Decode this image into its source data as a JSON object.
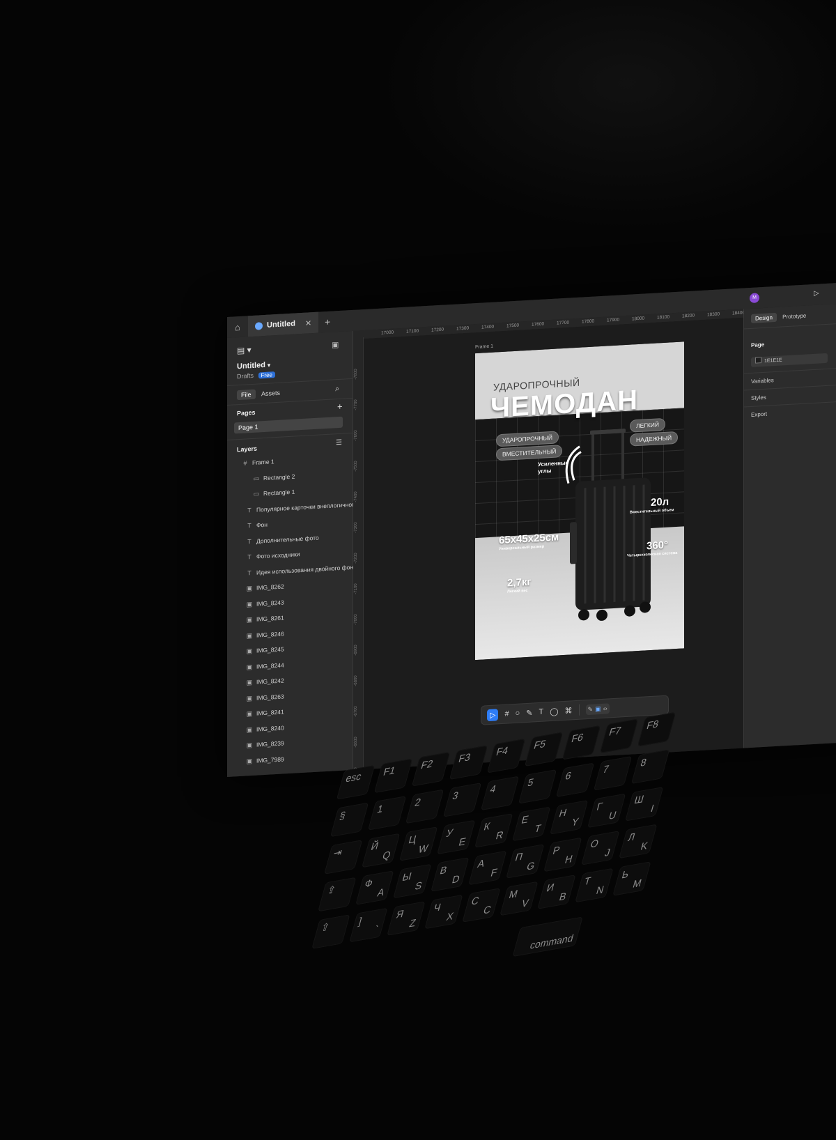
{
  "tab": {
    "title": "Untitled",
    "close": "✕",
    "add": "+"
  },
  "file": {
    "title": "Untitled",
    "location": "Drafts",
    "plan_badge": "Free"
  },
  "panel_tabs": {
    "file": "File",
    "assets": "Assets"
  },
  "pages": {
    "heading": "Pages",
    "add": "+",
    "items": [
      "Page 1"
    ]
  },
  "layers": {
    "heading": "Layers",
    "items": [
      {
        "name": "Frame 1",
        "icon": "frame-icon"
      },
      {
        "name": "Rectangle 2",
        "icon": "rectangle-icon"
      },
      {
        "name": "Rectangle 1",
        "icon": "rectangle-icon"
      },
      {
        "name": "Популярное карточки внеплогичного",
        "icon": "text-icon"
      },
      {
        "name": "Фон",
        "icon": "text-icon"
      },
      {
        "name": "Дополнительные фото",
        "icon": "text-icon"
      },
      {
        "name": "Фото исходники",
        "icon": "text-icon"
      },
      {
        "name": "Идея использования двойного фона",
        "icon": "text-icon"
      },
      {
        "name": "IMG_8262",
        "icon": "image-icon"
      },
      {
        "name": "IMG_8243",
        "icon": "image-icon"
      },
      {
        "name": "IMG_8261",
        "icon": "image-icon"
      },
      {
        "name": "IMG_8246",
        "icon": "image-icon"
      },
      {
        "name": "IMG_8245",
        "icon": "image-icon"
      },
      {
        "name": "IMG_8244",
        "icon": "image-icon"
      },
      {
        "name": "IMG_8242",
        "icon": "image-icon"
      },
      {
        "name": "IMG_8263",
        "icon": "image-icon"
      },
      {
        "name": "IMG_8241",
        "icon": "image-icon"
      },
      {
        "name": "IMG_8240",
        "icon": "image-icon"
      },
      {
        "name": "IMG_8239",
        "icon": "image-icon"
      },
      {
        "name": "IMG_7989",
        "icon": "image-icon"
      }
    ]
  },
  "ruler": {
    "horizontal": [
      "17000",
      "17100",
      "17200",
      "17300",
      "17400",
      "17500",
      "17600",
      "17700",
      "17800",
      "17900",
      "18000",
      "18100",
      "18200",
      "18300",
      "18400"
    ],
    "vertical": [
      "-7800",
      "-7700",
      "-7600",
      "-7500",
      "-7400",
      "-7300",
      "-7200",
      "-7100",
      "-7000",
      "-6900",
      "-6800",
      "-6700",
      "-6600",
      "-6500"
    ]
  },
  "canvas": {
    "frame_label": "Frame 1",
    "card": {
      "subtitle": "УДАРОПРОЧНЫЙ",
      "title": "ЧЕМОДАН",
      "pills": [
        "УДАРОПРОЧНЫЙ",
        "ВМЕСТИТЕЛЬНЫЙ",
        "ЛЕГКИЙ",
        "НАДЕЖНЫЙ"
      ],
      "corner_note": "Усиленные углы",
      "spec_size": "65x45x25см",
      "spec_size_sub": "Универсальный размер",
      "spec_weight": "2,7кг",
      "spec_weight_sub": "Легкий вес",
      "spec_volume": "20л",
      "spec_volume_sub": "Вместительный объем",
      "spec_rotation": "360°",
      "spec_rotation_sub": "Четырехколесная система"
    }
  },
  "toolbar": {
    "tools": [
      "▷",
      "#",
      "○",
      "✎",
      "T",
      "◯",
      "⌘"
    ]
  },
  "right_panel": {
    "avatar_letter": "M",
    "tabs": [
      "Design",
      "Prototype"
    ],
    "page_heading": "Page",
    "page_color": "1E1E1E",
    "variables": "Variables",
    "styles": "Styles",
    "export": "Export"
  },
  "keyboard": {
    "rows": [
      [
        "esc",
        "F1",
        "F2",
        "F3",
        "F4",
        "F5",
        "F6",
        "F7",
        "F8"
      ],
      [
        "§",
        "1",
        "2",
        "3",
        "4",
        "5",
        "6",
        "7",
        "8"
      ],
      [
        "⇥",
        "Й Q",
        "Ц W",
        "У E",
        "К R",
        "Е T",
        "Н Y",
        "Г U",
        "Ш I"
      ],
      [
        "⇪",
        "Ф A",
        "Ы S",
        "В D",
        "А F",
        "П G",
        "Р H",
        "О J",
        "Л K"
      ],
      [
        "⇧",
        "] `",
        "Я Z",
        "Ч X",
        "С C",
        "М V",
        "И B",
        "Т N",
        "Ь M"
      ]
    ],
    "modifier": "command"
  },
  "colors": {
    "accent": "#2d7cf6",
    "panel": "#2c2c2c",
    "canvas": "#1c1c1c"
  }
}
